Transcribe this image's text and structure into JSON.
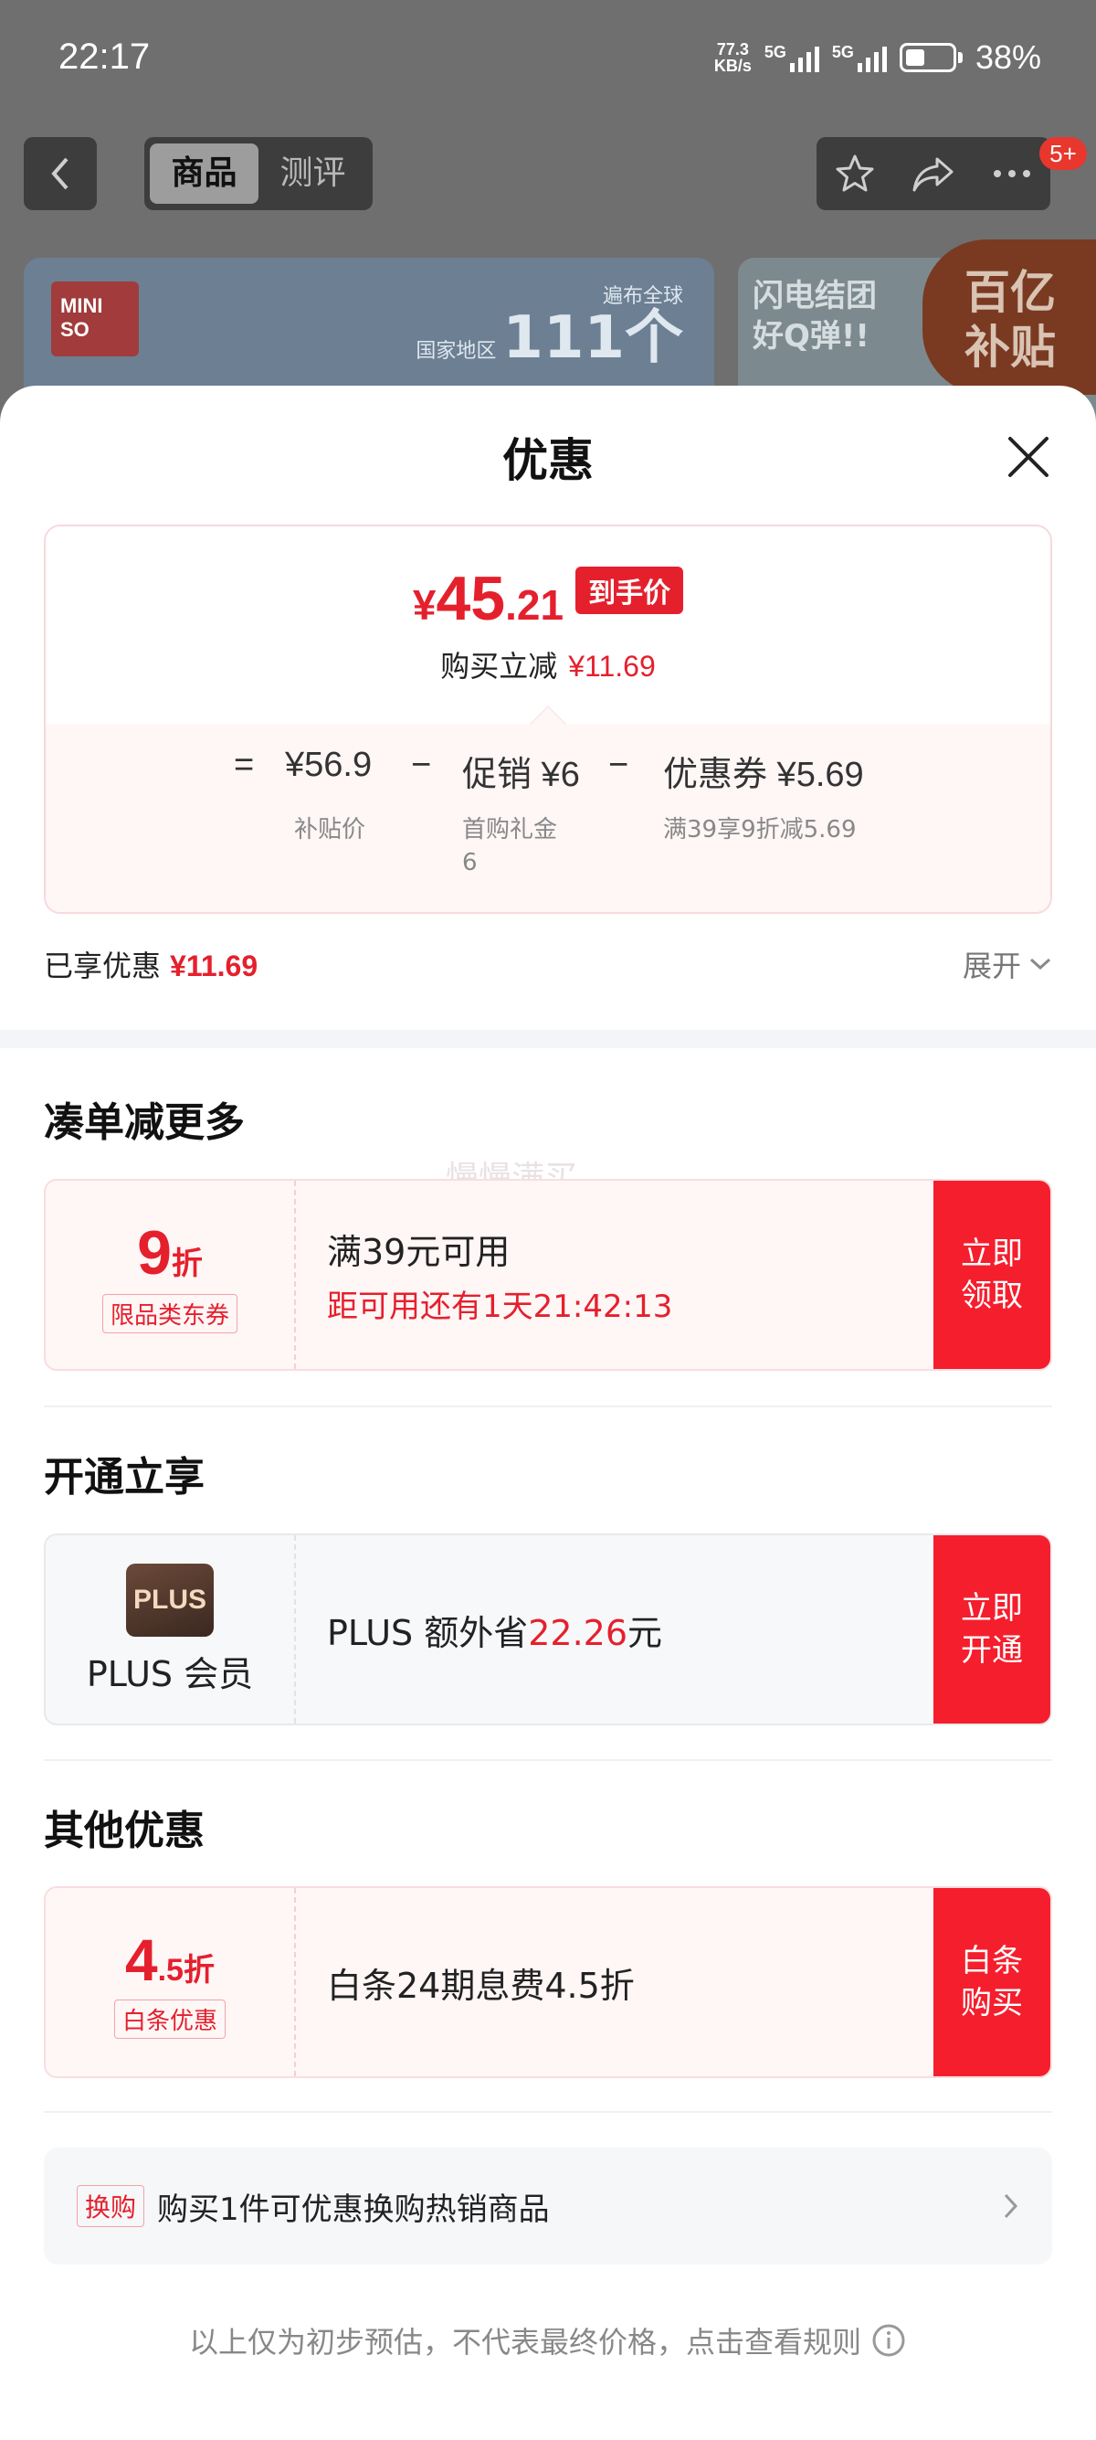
{
  "status_bar": {
    "time": "22:17",
    "net_speed_value": "77.3",
    "net_speed_unit": "KB/s",
    "sim1": "5G",
    "sim2": "5G",
    "battery": "38%"
  },
  "nav": {
    "tabs": [
      {
        "label": "商品"
      },
      {
        "label": "测评"
      }
    ],
    "badge": "5+"
  },
  "background": {
    "banner1_stat_text": "遍布全球\n国家地区",
    "banner1_stat_number": "111个",
    "banner2_text": "闪电结团\n好Q弹!!",
    "subsidy_badge": "百亿\n补贴",
    "brand_logo": "MINISO"
  },
  "sheet": {
    "title": "优惠",
    "price": {
      "currency": "¥",
      "integer": "45",
      "decimal": ".21",
      "tag": "到手价",
      "reduce_label": "购买立减",
      "reduce_value": "¥11.69"
    },
    "calc": {
      "equals": "=",
      "base_price": "¥56.9",
      "base_label": "补贴价",
      "minus1": "−",
      "promo": "促销 ¥6",
      "promo_label": "首购礼金",
      "promo_label2": "6",
      "minus2": "−",
      "coupon": "优惠券 ¥5.69",
      "coupon_label": "满39享9折减5.69"
    },
    "enjoyed": {
      "label": "已享优惠",
      "value": "¥11.69",
      "expand": "展开"
    },
    "sections": [
      {
        "title": "凑单减更多",
        "watermark": "慢慢满买"
      },
      {
        "title": "开通立享"
      },
      {
        "title": "其他优惠"
      }
    ],
    "coupon1": {
      "num": "9",
      "unit": "折",
      "tag": "限品类东券",
      "main": "满39元可用",
      "sub": "距可用还有1天21:42:13",
      "btn": "立即\n领取"
    },
    "coupon2": {
      "logo": "PLUS",
      "name": "PLUS 会员",
      "main_prefix": "PLUS 额外省",
      "main_value": "22.26",
      "main_suffix": "元",
      "btn": "立即\n开通"
    },
    "coupon3": {
      "num": "4",
      "num_decimal": ".5",
      "unit": "折",
      "tag": "白条优惠",
      "main": "白条24期息费4.5折",
      "btn": "白条\n购买"
    },
    "trade": {
      "tag": "换购",
      "text": "购买1件可优惠换购热销商品"
    },
    "footnote": "以上仅为初步预估，不代表最终价格，点击查看规则"
  },
  "colors": {
    "accent": "#e5202d",
    "button": "#f51e2d"
  },
  "icons": [
    "back-icon",
    "star-icon",
    "share-icon",
    "more-icon",
    "close-icon",
    "chevron-down-icon",
    "chevron-right-icon",
    "info-icon"
  ]
}
